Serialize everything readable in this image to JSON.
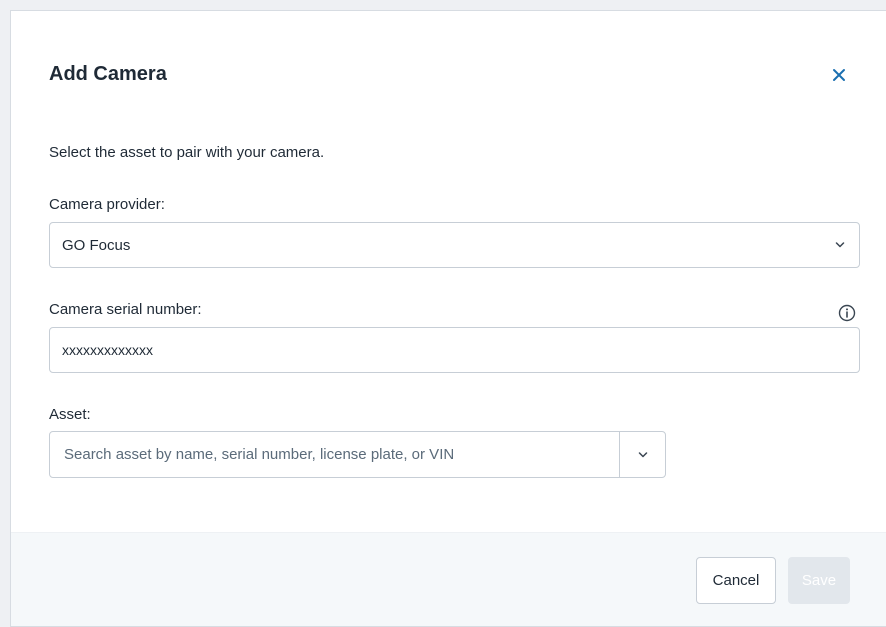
{
  "dialog": {
    "title": "Add Camera",
    "instruction": "Select the asset to pair with your camera."
  },
  "camera_provider": {
    "label": "Camera provider:",
    "selected_value": "GO Focus"
  },
  "serial_number": {
    "label": "Camera serial number:",
    "value": "xxxxxxxxxxxxx"
  },
  "asset": {
    "label": "Asset:",
    "placeholder": "Search asset by name, serial number, license plate, or VIN"
  },
  "footer": {
    "cancel_label": "Cancel",
    "save_label": "Save"
  },
  "icons": {
    "close": "close-icon",
    "provider_chevron": "chevron-down-icon",
    "info": "info-icon",
    "asset_chevron": "chevron-down-icon"
  },
  "colors": {
    "accent": "#1a6fb0",
    "footer_bg": "#f5f8fa",
    "save_disabled_bg": "#e2e7ec"
  }
}
